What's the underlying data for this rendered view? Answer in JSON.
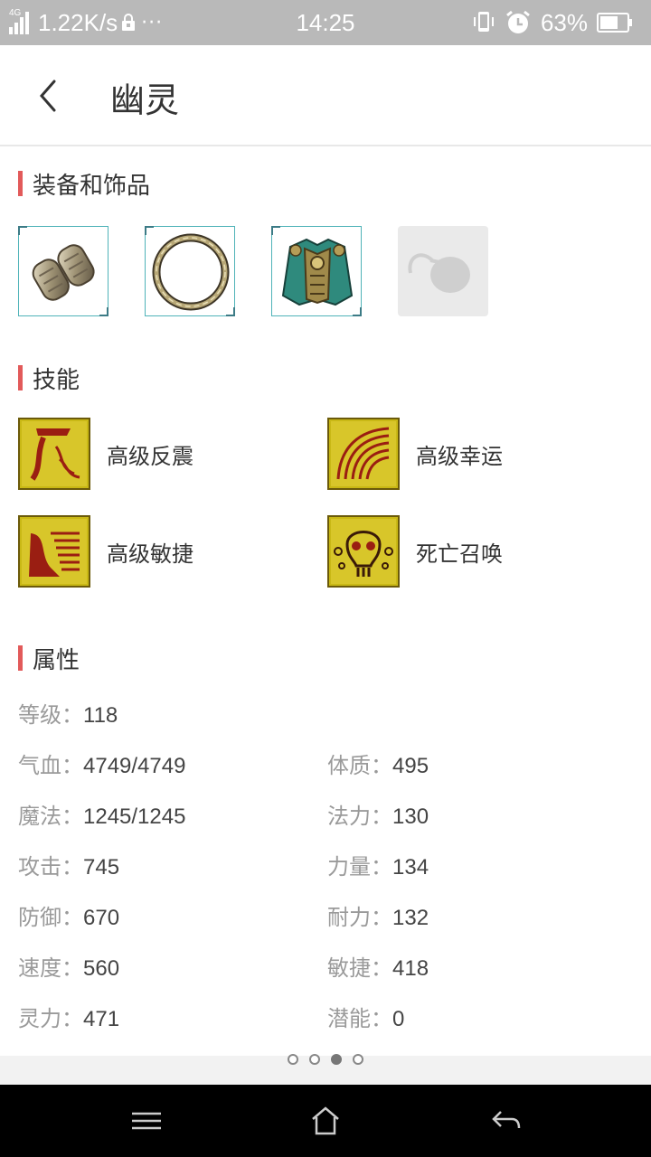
{
  "status_bar": {
    "network": "4G",
    "speed": "1.22K/s",
    "more": "···",
    "time": "14:25",
    "battery": "63%"
  },
  "header": {
    "title": "幽灵"
  },
  "equipment": {
    "title": "装备和饰品",
    "items": [
      {
        "icon": "bracer-icon"
      },
      {
        "icon": "ring-icon"
      },
      {
        "icon": "armor-icon"
      },
      {
        "icon": "empty-slot-icon"
      }
    ]
  },
  "skills": {
    "title": "技能",
    "items": [
      {
        "name": "高级反震",
        "icon": "counter-skill-icon"
      },
      {
        "name": "高级幸运",
        "icon": "luck-skill-icon"
      },
      {
        "name": "高级敏捷",
        "icon": "agility-skill-icon"
      },
      {
        "name": "死亡召唤",
        "icon": "death-summon-skill-icon"
      }
    ]
  },
  "attributes": {
    "title": "属性",
    "level": {
      "label": "等级：",
      "value": "118"
    },
    "left": [
      {
        "label": "气血：",
        "value": "4749/4749"
      },
      {
        "label": "魔法：",
        "value": "1245/1245"
      },
      {
        "label": "攻击：",
        "value": "745"
      },
      {
        "label": "防御：",
        "value": "670"
      },
      {
        "label": "速度：",
        "value": "560"
      },
      {
        "label": "灵力：",
        "value": "471"
      }
    ],
    "right": [
      {
        "label": "体质：",
        "value": "495"
      },
      {
        "label": "法力：",
        "value": "130"
      },
      {
        "label": "力量：",
        "value": "134"
      },
      {
        "label": "耐力：",
        "value": "132"
      },
      {
        "label": "敏捷：",
        "value": "418"
      },
      {
        "label": "潜能：",
        "value": "0"
      }
    ]
  },
  "pager": {
    "page_count": 4,
    "active_index": 2
  },
  "colors": {
    "accent": "#e25a5a",
    "status_bar": "#b9b9b9",
    "skill_bg": "#c9b815"
  }
}
